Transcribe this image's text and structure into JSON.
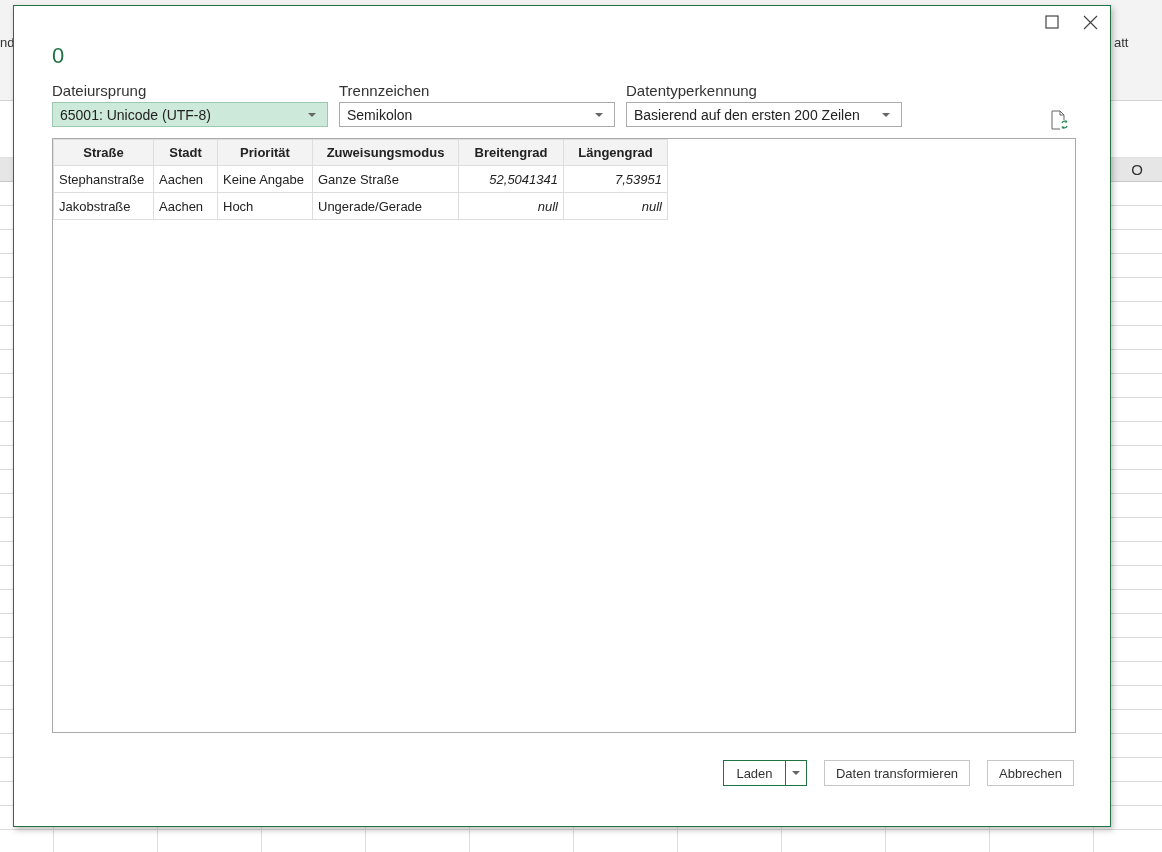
{
  "excel": {
    "ribbon_texts": [
      {
        "text": "nd",
        "kind": "left"
      },
      {
        "text": "att",
        "kind": "right"
      }
    ],
    "column_header": "O"
  },
  "dialog": {
    "title": "0",
    "fields": [
      {
        "label": "Dateiursprung",
        "value": "65001: Unicode (UTF-8)",
        "focused": true
      },
      {
        "label": "Trennzeichen",
        "value": "Semikolon",
        "focused": false
      },
      {
        "label": "Datentyperkennung",
        "value": "Basierend auf den ersten 200 Zeilen",
        "focused": false
      }
    ],
    "table": {
      "columns": [
        {
          "label": "Straße",
          "kind": "text"
        },
        {
          "label": "Stadt",
          "kind": "text"
        },
        {
          "label": "Priorität",
          "kind": "text"
        },
        {
          "label": "Zuweisungsmodus",
          "kind": "text"
        },
        {
          "label": "Breitengrad",
          "kind": "number"
        },
        {
          "label": "Längengrad",
          "kind": "number"
        }
      ],
      "rows": [
        [
          "Stephanstraße",
          "Aachen",
          "Keine Angabe",
          "Ganze Straße",
          "52,5041341",
          "7,53951"
        ],
        [
          "Jakobstraße",
          "Aachen",
          "Hoch",
          "Ungerade/Gerade",
          "null",
          "null"
        ]
      ]
    },
    "buttons": [
      {
        "label": "Laden",
        "kind": "split"
      },
      {
        "label": "Daten transformieren",
        "kind": "plain"
      },
      {
        "label": "Abbrechen",
        "kind": "plain"
      }
    ]
  }
}
